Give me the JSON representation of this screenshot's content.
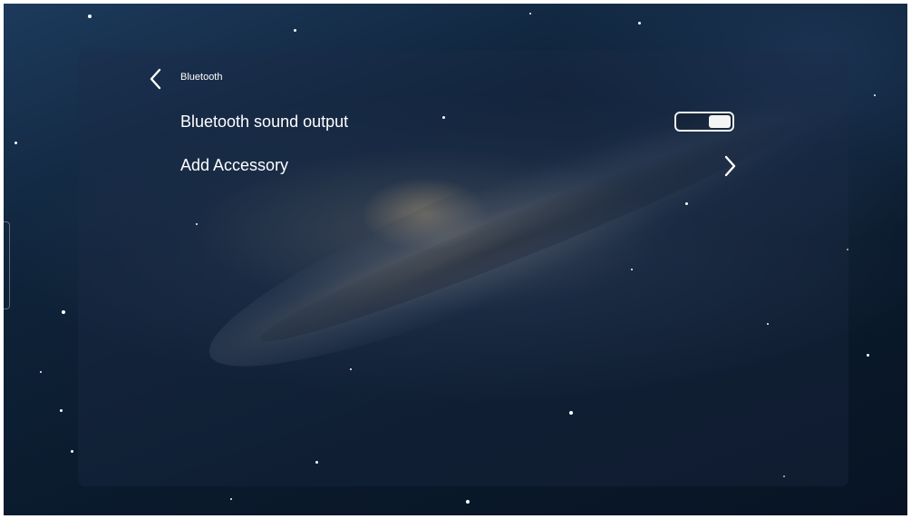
{
  "header": {
    "title": "Bluetooth",
    "back_icon": "chevron-left-icon"
  },
  "settings": [
    {
      "label": "Bluetooth sound output",
      "control": "toggle",
      "value": "on",
      "icon": "toggle-switch-icon"
    },
    {
      "label": "Add Accessory",
      "control": "link",
      "icon": "chevron-right-icon"
    }
  ],
  "colors": {
    "text": "#ffffff",
    "toggle_border": "#f2f2f2",
    "background": "#0e2238"
  }
}
